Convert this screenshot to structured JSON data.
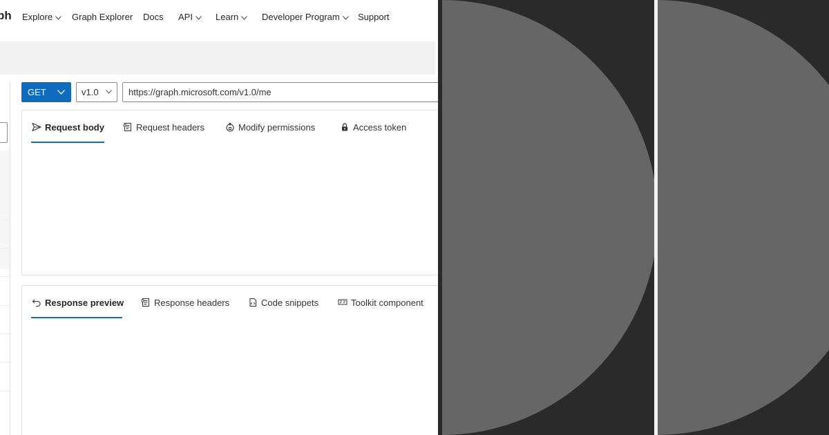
{
  "brand": {
    "text": "ph"
  },
  "nav": {
    "items": [
      {
        "label": "Explore",
        "has_chevron": true
      },
      {
        "label": "Graph Explorer",
        "has_chevron": false
      },
      {
        "label": "Docs",
        "has_chevron": false
      },
      {
        "label": "API",
        "has_chevron": true
      },
      {
        "label": "Learn",
        "has_chevron": true
      },
      {
        "label": "Developer Program",
        "has_chevron": true
      },
      {
        "label": "Support",
        "has_chevron": false
      }
    ]
  },
  "query": {
    "method": "GET",
    "version": "v1.0",
    "url": "https://graph.microsoft.com/v1.0/me"
  },
  "request_tabs": [
    {
      "label": "Request body",
      "icon": "send-icon",
      "active": true
    },
    {
      "label": "Request headers",
      "icon": "document-icon",
      "active": false
    },
    {
      "label": "Modify permissions",
      "icon": "permissions-icon",
      "active": false
    },
    {
      "label": "Access token",
      "icon": "lock-icon",
      "active": false
    }
  ],
  "response_tabs": [
    {
      "label": "Response preview",
      "icon": "undo-arrow-icon",
      "active": true
    },
    {
      "label": "Response headers",
      "icon": "document-icon",
      "active": false
    },
    {
      "label": "Code snippets",
      "icon": "code-file-icon",
      "active": false
    },
    {
      "label": "Toolkit component",
      "icon": "toolkit-icon",
      "active": false
    }
  ],
  "colors": {
    "accent": "#0f6cbd",
    "art_background": "#2a2a2a",
    "art_shape": "#666666",
    "divider": "#f2f2f2"
  }
}
